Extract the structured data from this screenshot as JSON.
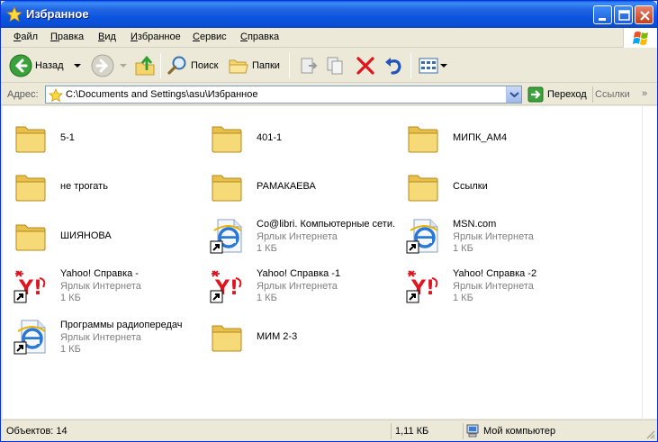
{
  "window": {
    "title": "Избранное",
    "title_icon": "favorites-star-icon"
  },
  "menu": [
    {
      "label": "Файл",
      "accel": "Ф",
      "rest": "айл"
    },
    {
      "label": "Правка",
      "accel": "П",
      "rest": "равка"
    },
    {
      "label": "Вид",
      "accel": "В",
      "rest": "ид"
    },
    {
      "label": "Избранное",
      "accel": "И",
      "rest": "збранное"
    },
    {
      "label": "Сервис",
      "accel": "С",
      "rest": "ервис"
    },
    {
      "label": "Справка",
      "accel": "С",
      "rest": "правка"
    }
  ],
  "toolbar": {
    "back_label": "Назад",
    "search_label": "Поиск",
    "folders_label": "Папки"
  },
  "address": {
    "label": "Адрес:",
    "path": "C:\\Documents and Settings\\asu\\Избранное",
    "go_label": "Переход",
    "links_label": "Ссылки"
  },
  "items": [
    {
      "name": "5-1",
      "type": "folder",
      "icon": "folder-icon"
    },
    {
      "name": "401-1",
      "type": "folder",
      "icon": "folder-icon"
    },
    {
      "name": "МИПК_АМ4",
      "type": "folder",
      "icon": "folder-icon"
    },
    {
      "name": "не трогать",
      "type": "folder",
      "icon": "folder-icon"
    },
    {
      "name": "РАМАКАЕВА",
      "type": "folder",
      "icon": "folder-icon"
    },
    {
      "name": "Ссылки",
      "type": "folder",
      "icon": "folder-icon"
    },
    {
      "name": "ШИЯНОВА",
      "type": "folder",
      "icon": "folder-icon"
    },
    {
      "name": "Co@libri. Компьютерные сети.",
      "type": "ie",
      "kind": "Ярлык Интернета",
      "size": "1 КБ",
      "icon": "ie-shortcut-icon"
    },
    {
      "name": "MSN.com",
      "type": "ie",
      "kind": "Ярлык Интернета",
      "size": "1 КБ",
      "icon": "ie-shortcut-icon"
    },
    {
      "name": "Yahoo! Справка -",
      "type": "yahoo",
      "kind": "Ярлык Интернета",
      "size": "1 КБ",
      "icon": "yahoo-shortcut-icon"
    },
    {
      "name": "Yahoo! Справка -1",
      "type": "yahoo",
      "kind": "Ярлык Интернета",
      "size": "1 КБ",
      "icon": "yahoo-shortcut-icon"
    },
    {
      "name": "Yahoo! Справка -2",
      "type": "yahoo",
      "kind": "Ярлык Интернета",
      "size": "1 КБ",
      "icon": "yahoo-shortcut-icon"
    },
    {
      "name": "Программы радиопередач",
      "type": "ie",
      "kind": "Ярлык Интернета",
      "size": "1 КБ",
      "icon": "ie-shortcut-icon"
    },
    {
      "name": "МИМ 2-3",
      "type": "folder",
      "icon": "folder-icon"
    }
  ],
  "status": {
    "objects": "Объектов: 14",
    "size": "1,11 КБ",
    "location": "Мой компьютер"
  },
  "colors": {
    "titlebar": "#0A5FE8",
    "chrome": "#ECE9D8",
    "folder": "#F5D66E",
    "yahoo_red": "#E0141E"
  }
}
